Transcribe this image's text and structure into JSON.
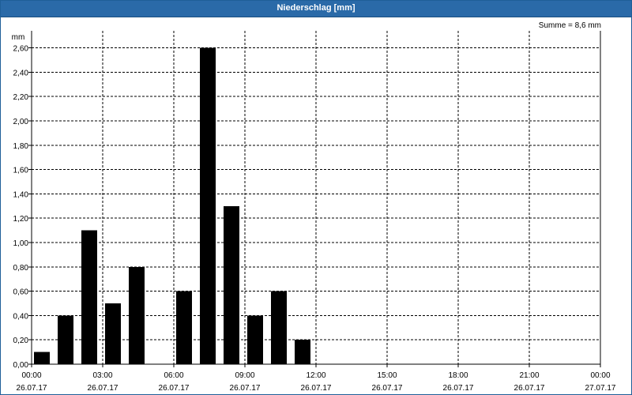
{
  "window": {
    "title": "Niederschlag [mm]"
  },
  "summary": {
    "text": "Summe = 8,6 mm"
  },
  "chart_data": {
    "type": "bar",
    "title": "Niederschlag [mm]",
    "ylabel": "mm",
    "xlabel": "",
    "ylim": [
      0,
      2.7
    ],
    "xlim_hours": [
      0,
      24
    ],
    "bar_color": "#000000",
    "grid": true,
    "y_ticks": [
      {
        "value": 0,
        "label": "0,00"
      },
      {
        "value": 0.2,
        "label": "0,20"
      },
      {
        "value": 0.4,
        "label": "0,40"
      },
      {
        "value": 0.6,
        "label": "0,60"
      },
      {
        "value": 0.8,
        "label": "0,80"
      },
      {
        "value": 1.0,
        "label": "1,00"
      },
      {
        "value": 1.2,
        "label": "1,20"
      },
      {
        "value": 1.4,
        "label": "1,40"
      },
      {
        "value": 1.6,
        "label": "1,60"
      },
      {
        "value": 1.8,
        "label": "1,80"
      },
      {
        "value": 2.0,
        "label": "2,00"
      },
      {
        "value": 2.2,
        "label": "2,20"
      },
      {
        "value": 2.4,
        "label": "2,40"
      },
      {
        "value": 2.6,
        "label": "2,60"
      }
    ],
    "x_ticks": [
      {
        "hour": 0,
        "time": "00:00",
        "date": "26.07.17"
      },
      {
        "hour": 3,
        "time": "03:00",
        "date": "26.07.17"
      },
      {
        "hour": 6,
        "time": "06:00",
        "date": "26.07.17"
      },
      {
        "hour": 9,
        "time": "09:00",
        "date": "26.07.17"
      },
      {
        "hour": 12,
        "time": "12:00",
        "date": "26.07.17"
      },
      {
        "hour": 15,
        "time": "15:00",
        "date": "26.07.17"
      },
      {
        "hour": 18,
        "time": "18:00",
        "date": "26.07.17"
      },
      {
        "hour": 21,
        "time": "21:00",
        "date": "26.07.17"
      },
      {
        "hour": 24,
        "time": "00:00",
        "date": "27.07.17"
      }
    ],
    "bars": [
      {
        "hour": 0,
        "value": 0.1
      },
      {
        "hour": 1,
        "value": 0.4
      },
      {
        "hour": 2,
        "value": 1.1
      },
      {
        "hour": 3,
        "value": 0.5
      },
      {
        "hour": 4,
        "value": 0.8
      },
      {
        "hour": 6,
        "value": 0.6
      },
      {
        "hour": 7,
        "value": 2.6
      },
      {
        "hour": 8,
        "value": 1.3
      },
      {
        "hour": 9,
        "value": 0.4
      },
      {
        "hour": 10,
        "value": 0.6
      },
      {
        "hour": 11,
        "value": 0.2
      }
    ]
  }
}
